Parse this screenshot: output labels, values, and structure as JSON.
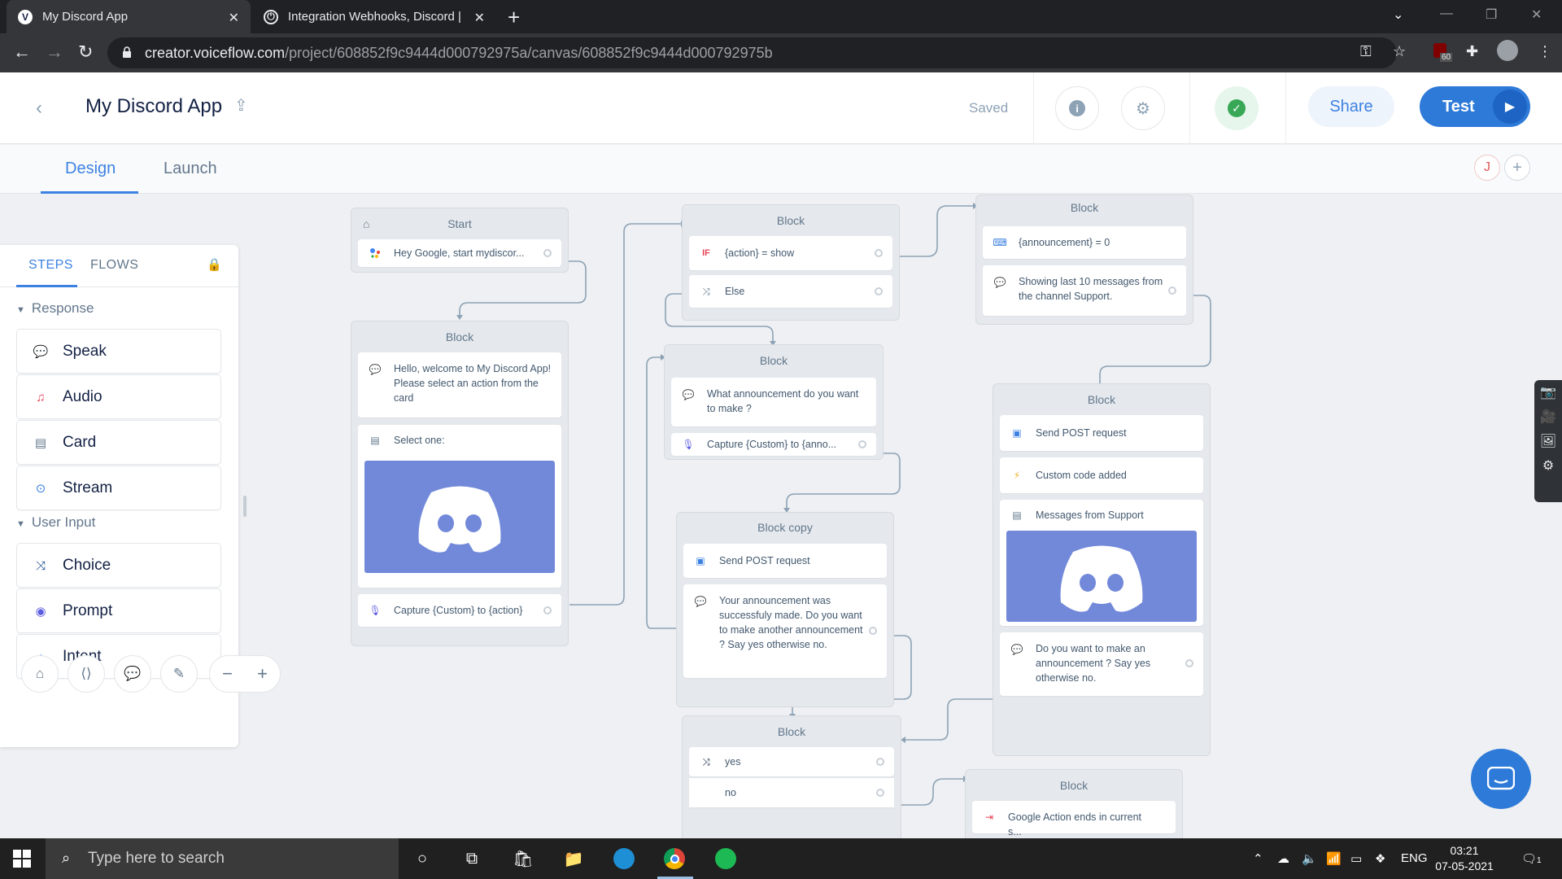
{
  "browser": {
    "tabs": [
      {
        "title": "My Discord App",
        "icon": "voiceflow-icon"
      },
      {
        "title": "Integration Webhooks, Discord |",
        "icon": "power-icon"
      }
    ],
    "url_host": "creator.voiceflow.com",
    "url_path": "/project/608852f9c9444d000792975a/canvas/608852f9c9444d000792975b",
    "extension_badge": "60"
  },
  "header": {
    "project_name": "My Discord App",
    "status": "Saved",
    "share_label": "Share",
    "test_label": "Test"
  },
  "subtabs": {
    "design": "Design",
    "launch": "Launch",
    "avatar_initial": "J"
  },
  "panel": {
    "tabs": [
      "STEPS",
      "FLOWS"
    ],
    "response_label": "Response",
    "response_steps": [
      "Speak",
      "Audio",
      "Card",
      "Stream"
    ],
    "user_input_label": "User Input",
    "user_input_steps": [
      "Choice",
      "Prompt",
      "Intent"
    ],
    "colors": {
      "audio": "#e8445a",
      "accent": "#3d82e2"
    }
  },
  "blocks": {
    "start": {
      "title": "Start",
      "intent": "Hey Google, start mydiscor..."
    },
    "welcome": {
      "title": "Block",
      "speak": "Hello, welcome to My Discord App! Please select an action from the card",
      "card": "Select one:",
      "capture": "Capture {Custom} to {action}"
    },
    "ifblock": {
      "title": "Block",
      "if_prefix": "IF",
      "condition": "{action} = show",
      "else": "Else"
    },
    "announce": {
      "title": "Block",
      "set": "{announcement} = 0",
      "speak": "Showing last 10 messages from the channel Support."
    },
    "askannounce": {
      "title": "Block",
      "speak": "What announcement do you want to make ?",
      "capture": "Capture {Custom} to {anno..."
    },
    "blockcopy": {
      "title": "Block copy",
      "api": "Send POST request",
      "speak": "Your announcement was successfuly made. Do you want to make another announcement ? Say yes otherwise no."
    },
    "support": {
      "title": "Block",
      "api": "Send POST request",
      "code": "Custom code added",
      "card": "Messages from Support",
      "speak": "Do you want to make an announcement ? Say yes otherwise no."
    },
    "choice": {
      "title": "Block",
      "yes": "yes",
      "no": "no"
    },
    "exit": {
      "title": "Block",
      "exit": "Google Action ends in current s..."
    }
  },
  "taskbar": {
    "search_placeholder": "Type here to search",
    "language": "ENG",
    "time": "03:21",
    "date": "07-05-2021",
    "notification_count": "1"
  }
}
